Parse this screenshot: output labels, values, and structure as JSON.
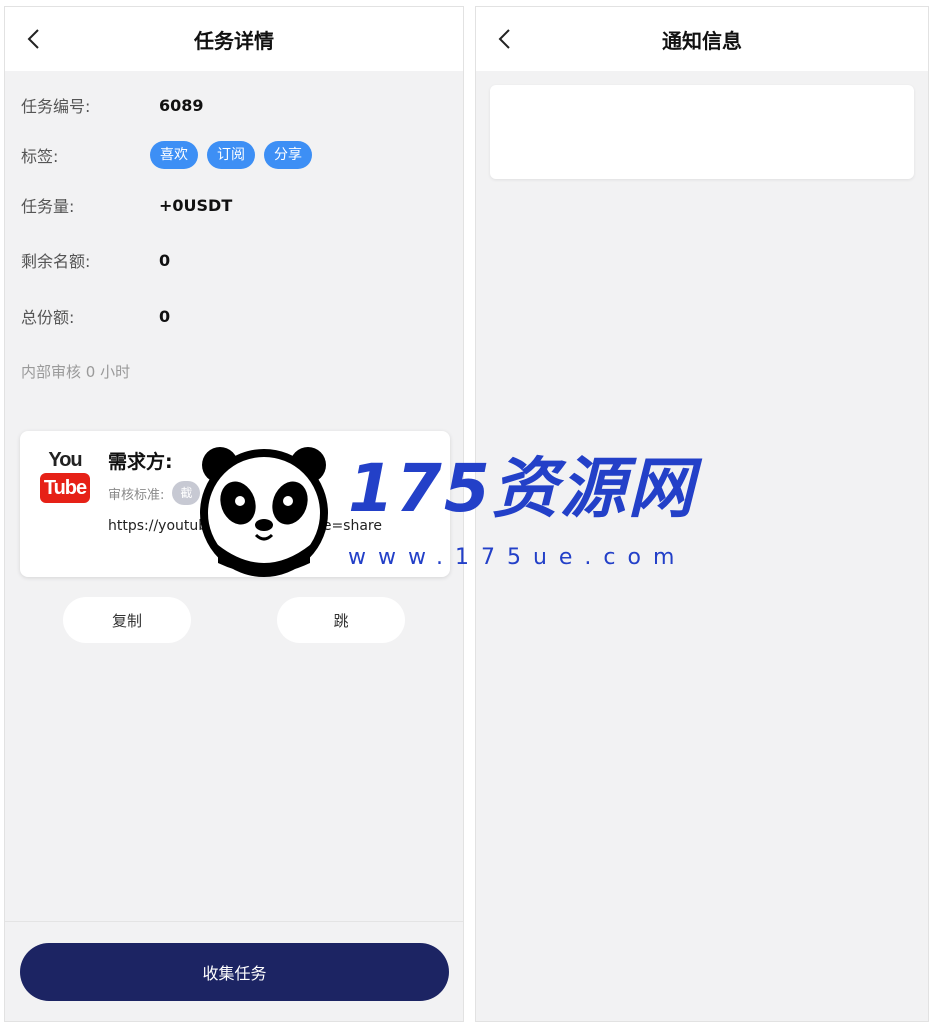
{
  "left": {
    "title": "任务详情",
    "fields": {
      "task_no_label": "任务编号:",
      "task_no_value": "6089",
      "tags_label": "标签:",
      "tags": [
        "喜欢",
        "订阅",
        "分享"
      ],
      "amount_label": "任务量:",
      "amount_value": "+0USDT",
      "remaining_label": "剩余名额:",
      "remaining_value": "0",
      "total_label": "总份额:",
      "total_value": "0"
    },
    "review_note": "内部审核 0 小时",
    "card": {
      "logo_you": "You",
      "logo_tube": "Tube",
      "title": "需求方:",
      "criteria_label": "审核标准:",
      "criteria_badge": "截",
      "url": "https://youtub                              stt26Bgs?feature=share"
    },
    "buttons": {
      "copy": "复制",
      "jump": "跳",
      "collect": "收集任务"
    }
  },
  "right": {
    "title": "通知信息"
  },
  "watermark": {
    "text": "175资源网",
    "url": "www.175ue.com"
  },
  "colors": {
    "tag_blue": "#3d8ff5",
    "primary_navy": "#1c2463",
    "youtube_red": "#e62117",
    "watermark_blue": "#2340c8"
  }
}
